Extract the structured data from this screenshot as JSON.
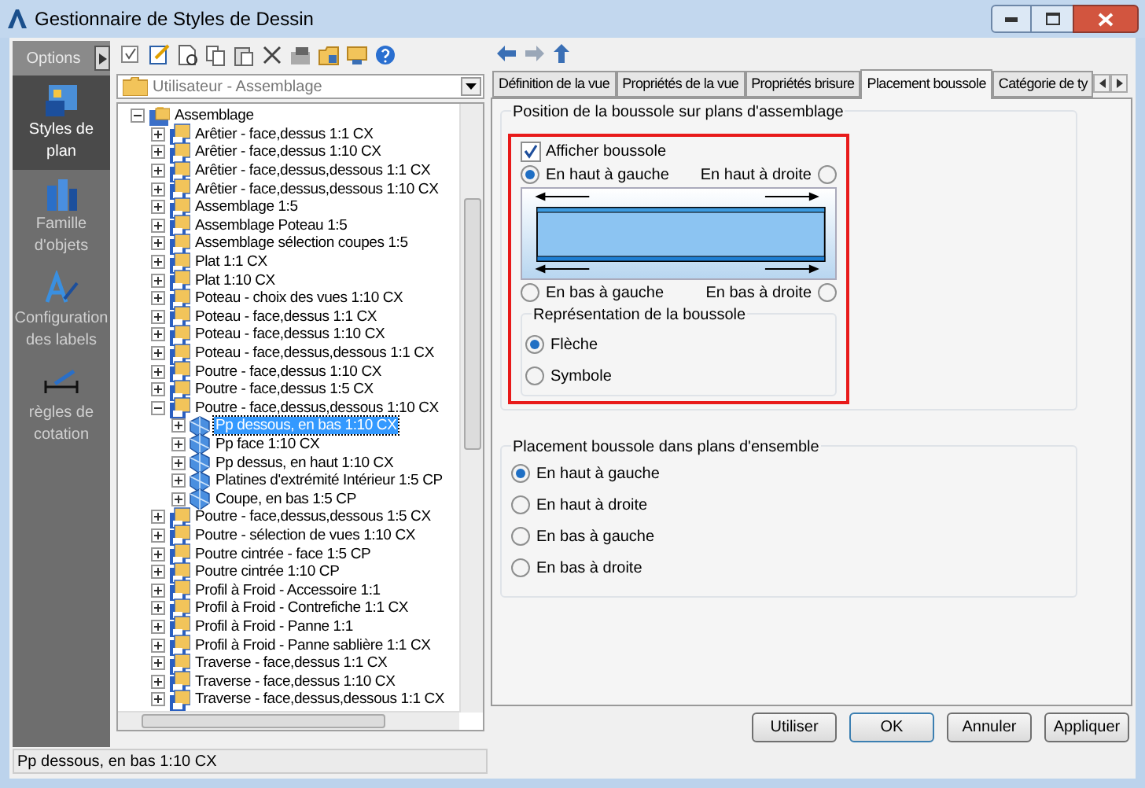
{
  "window": {
    "title": "Gestionnaire de Styles de Dessin"
  },
  "sidebar": {
    "header": "Options",
    "items": [
      {
        "label": "Styles de plan",
        "selected": true,
        "kind": "plan"
      },
      {
        "label": "Famille d'objets",
        "selected": false,
        "kind": "family"
      },
      {
        "label": "Configuration des labels",
        "selected": false,
        "kind": "labels"
      },
      {
        "label": "règles de cotation",
        "selected": false,
        "kind": "dimension"
      }
    ]
  },
  "combo": {
    "value": "Utilisateur - Assemblage"
  },
  "tree": [
    {
      "label": "Assemblage",
      "expanded": true,
      "selected": false,
      "children": [
        {
          "label": "Arêtier - face,dessus 1:1 CX",
          "expanded": false,
          "selected": false
        },
        {
          "label": "Arêtier - face,dessus 1:10 CX",
          "expanded": false,
          "selected": false
        },
        {
          "label": "Arêtier - face,dessus,dessous 1:1 CX",
          "expanded": false,
          "selected": false
        },
        {
          "label": "Arêtier - face,dessus,dessous 1:10 CX",
          "expanded": false,
          "selected": false
        },
        {
          "label": "Assemblage 1:5",
          "expanded": false,
          "selected": false
        },
        {
          "label": "Assemblage Poteau 1:5",
          "expanded": false,
          "selected": false
        },
        {
          "label": "Assemblage sélection coupes 1:5",
          "expanded": false,
          "selected": false
        },
        {
          "label": "Plat 1:1 CX",
          "expanded": false,
          "selected": false
        },
        {
          "label": "Plat 1:10 CX",
          "expanded": false,
          "selected": false
        },
        {
          "label": "Poteau - choix des vues 1:10 CX",
          "expanded": false,
          "selected": false
        },
        {
          "label": "Poteau - face,dessus 1:1 CX",
          "expanded": false,
          "selected": false
        },
        {
          "label": "Poteau - face,dessus 1:10 CX",
          "expanded": false,
          "selected": false
        },
        {
          "label": "Poteau - face,dessus,dessous 1:1 CX",
          "expanded": false,
          "selected": false
        },
        {
          "label": "Poutre - face,dessus 1:10 CX",
          "expanded": false,
          "selected": false
        },
        {
          "label": "Poutre - face,dessus 1:5 CX",
          "expanded": false,
          "selected": false
        },
        {
          "label": "Poutre - face,dessus,dessous 1:10 CX",
          "expanded": true,
          "selected": false,
          "children": [
            {
              "label": "Pp dessous, en bas 1:10 CX",
              "expanded": false,
              "selected": true
            },
            {
              "label": "Pp face 1:10 CX",
              "expanded": false,
              "selected": false
            },
            {
              "label": "Pp dessus, en haut 1:10 CX",
              "expanded": false,
              "selected": false
            },
            {
              "label": "Platines d'extrémité Intérieur 1:5 CP",
              "expanded": false,
              "selected": false
            },
            {
              "label": "Coupe, en bas 1:5 CP",
              "expanded": false,
              "selected": false
            }
          ]
        },
        {
          "label": "Poutre - face,dessus,dessous 1:5 CX",
          "expanded": false,
          "selected": false
        },
        {
          "label": "Poutre - sélection de vues 1:10 CX",
          "expanded": false,
          "selected": false
        },
        {
          "label": "Poutre cintrée - face 1:5 CP",
          "expanded": false,
          "selected": false
        },
        {
          "label": "Poutre cintrée 1:10 CP",
          "expanded": false,
          "selected": false
        },
        {
          "label": "Profil à Froid - Accessoire 1:1",
          "expanded": false,
          "selected": false
        },
        {
          "label": "Profil à Froid - Contrefiche 1:1 CX",
          "expanded": false,
          "selected": false
        },
        {
          "label": "Profil à Froid - Panne 1:1",
          "expanded": false,
          "selected": false
        },
        {
          "label": "Profil à Froid - Panne sablière 1:1 CX",
          "expanded": false,
          "selected": false
        },
        {
          "label": "Traverse - face,dessus 1:1 CX",
          "expanded": false,
          "selected": false
        },
        {
          "label": "Traverse - face,dessus 1:10 CX",
          "expanded": false,
          "selected": false
        },
        {
          "label": "Traverse - face,dessus,dessous 1:1 CX",
          "expanded": false,
          "selected": false
        }
      ]
    }
  ],
  "tabs": [
    {
      "label": "Définition de la vue",
      "selected": false
    },
    {
      "label": "Propriétés de la vue",
      "selected": false
    },
    {
      "label": "Propriétés brisure",
      "selected": false
    },
    {
      "label": "Placement boussole",
      "selected": true
    },
    {
      "label": "Catégorie de ty",
      "selected": false
    }
  ],
  "assembly_group": {
    "title": "Position de la boussole sur plans d'assemblage",
    "show_compass": {
      "label": "Afficher boussole",
      "checked": true
    },
    "positions": [
      {
        "label": "En haut à gauche",
        "selected": true
      },
      {
        "label": "En haut à droite",
        "selected": false
      },
      {
        "label": "En bas à gauche",
        "selected": false
      },
      {
        "label": "En bas à droite",
        "selected": false
      }
    ],
    "representation": {
      "title": "Représentation de la boussole",
      "options": [
        {
          "label": "Flèche",
          "selected": true
        },
        {
          "label": "Symbole",
          "selected": false
        }
      ]
    }
  },
  "overall_group": {
    "title": "Placement boussole dans plans d'ensemble",
    "options": [
      {
        "label": "En haut à gauche",
        "selected": true
      },
      {
        "label": "En haut à droite",
        "selected": false
      },
      {
        "label": "En bas à gauche",
        "selected": false
      },
      {
        "label": "En bas à droite",
        "selected": false
      }
    ]
  },
  "buttons": [
    {
      "label": "Utiliser",
      "default": false
    },
    {
      "label": "OK",
      "default": true
    },
    {
      "label": "Annuler",
      "default": false
    },
    {
      "label": "Appliquer",
      "default": false
    }
  ],
  "status_bar": "Pp dessous, en bas 1:10 CX"
}
